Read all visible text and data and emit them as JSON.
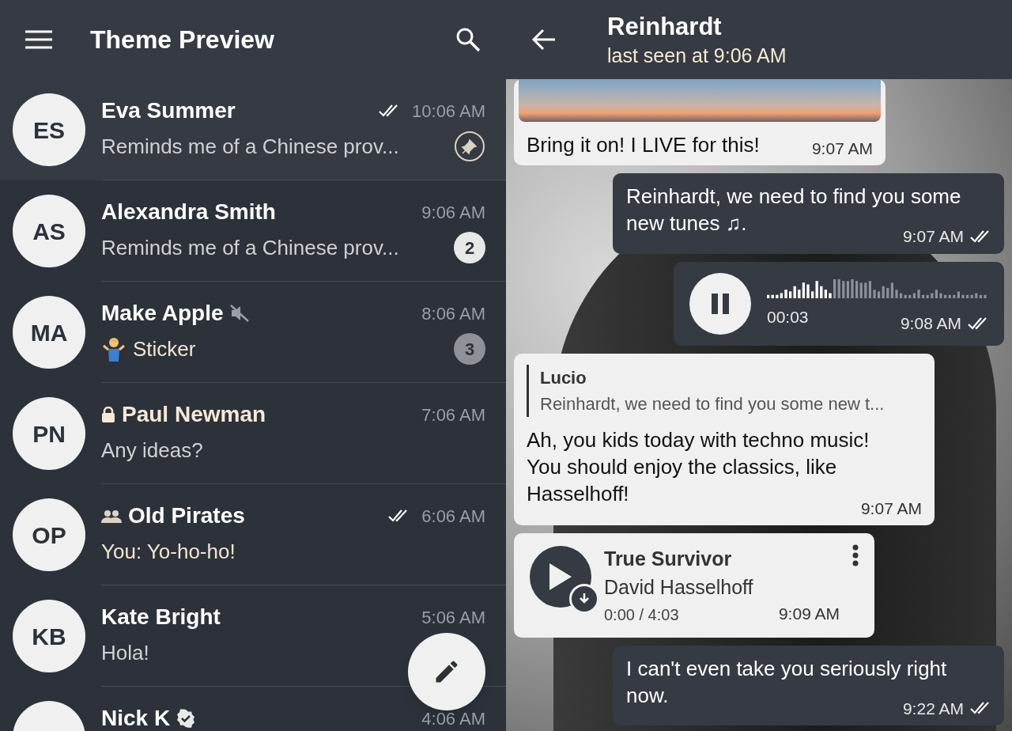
{
  "list_header": {
    "title": "Theme Preview"
  },
  "chats": [
    {
      "initials": "ES",
      "name": "Eva Summer",
      "time": "10:06 AM",
      "read": true,
      "preview": "Reminds me of a Chinese prov...",
      "pinned": true
    },
    {
      "initials": "AS",
      "name": "Alexandra Smith",
      "time": "9:06 AM",
      "preview": "Reminds me of a Chinese prov...",
      "pinned": false,
      "unread": {
        "count": "2",
        "muted": false
      }
    },
    {
      "initials": "MA",
      "name": "Make Apple",
      "muted": true,
      "time": "8:06 AM",
      "sticker": true,
      "preview": "Sticker",
      "preview_accent": true,
      "pinned": false,
      "unread": {
        "count": "3",
        "muted": true
      }
    },
    {
      "initials": "PN",
      "kind": "secret",
      "name": "Paul Newman",
      "name_accent": true,
      "time": "7:06 AM",
      "preview": "Any ideas?",
      "pinned": false
    },
    {
      "initials": "OP",
      "kind": "group",
      "name": "Old Pirates",
      "time": "6:06 AM",
      "read": true,
      "preview": "You: Yo-ho-ho!",
      "preview_accent": true,
      "pinned": false
    },
    {
      "initials": "KB",
      "name": "Kate Bright",
      "time": "5:06 AM",
      "preview": "Hola!",
      "pinned": false
    },
    {
      "name": "Nick K",
      "verified": true,
      "time": "4:06 AM",
      "pinned": false
    }
  ],
  "chat_header": {
    "title": "Reinhardt",
    "status": "last seen at 9:06 AM"
  },
  "messages": [
    {
      "kind": "photo",
      "outgoing": false,
      "text": "Bring it on! I LIVE for this!",
      "time": "9:07 AM"
    },
    {
      "kind": "text",
      "outgoing": true,
      "text": "Reinhardt, we need to find you some new tunes ♫.",
      "time": "9:07 AM",
      "read": true
    },
    {
      "kind": "voice",
      "outgoing": true,
      "playing": true,
      "level": 0.3,
      "duration": "00:03",
      "time": "9:08 AM",
      "read": true
    },
    {
      "kind": "reply",
      "outgoing": false,
      "reply_author": "Lucio",
      "reply_text": "Reinhardt, we need to find you some new t...",
      "text": "Ah, you kids today with techno music! You should enjoy the classics, like Hasselhoff!",
      "time": "9:07 AM"
    },
    {
      "kind": "audio",
      "outgoing": false,
      "title": "True Survivor",
      "artist": "David Hasselhoff",
      "progress": "0:00 / 4:03",
      "time": "9:09 AM"
    },
    {
      "kind": "text",
      "outgoing": true,
      "text": "I can't even take you seriously right now.",
      "time": "9:22 AM",
      "read": true
    }
  ]
}
